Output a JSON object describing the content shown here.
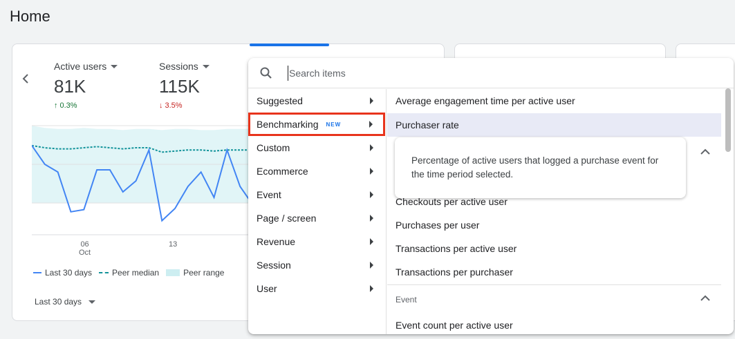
{
  "page": {
    "title": "Home"
  },
  "metrics": [
    {
      "label": "Active users",
      "value": "81K",
      "change": "0.3%",
      "direction": "up"
    },
    {
      "label": "Sessions",
      "value": "115K",
      "change": "3.5%",
      "direction": "down"
    }
  ],
  "chart_data": {
    "type": "line",
    "x_ticks": [
      {
        "day": "06",
        "month": "Oct"
      },
      {
        "day": "13",
        "month": ""
      }
    ],
    "series": [
      {
        "name": "Last 30 days",
        "color": "#4285f4",
        "style": "solid",
        "values": [
          0.82,
          0.65,
          0.58,
          0.22,
          0.24,
          0.6,
          0.6,
          0.4,
          0.5,
          0.78,
          0.14,
          0.25,
          0.45,
          0.58,
          0.35,
          0.78,
          0.45,
          0.28
        ]
      },
      {
        "name": "Peer median",
        "color": "#12939a",
        "style": "dashed",
        "values": [
          0.82,
          0.8,
          0.79,
          0.79,
          0.8,
          0.81,
          0.8,
          0.79,
          0.8,
          0.8,
          0.76,
          0.77,
          0.78,
          0.78,
          0.77,
          0.78,
          0.78,
          0.78
        ]
      },
      {
        "name": "Peer range",
        "color": "#cdeef1",
        "style": "area",
        "upper": [
          1.0,
          0.98,
          0.97,
          0.97,
          0.98,
          0.97,
          0.97,
          0.96,
          0.97,
          0.97,
          0.96,
          0.97,
          0.97,
          0.96,
          0.96,
          0.97,
          0.97,
          0.97
        ],
        "lower": [
          0.3,
          0.3,
          0.3,
          0.3,
          0.3,
          0.3,
          0.3,
          0.3,
          0.3,
          0.3,
          0.3,
          0.3,
          0.3,
          0.3,
          0.3,
          0.3,
          0.3,
          0.3
        ]
      }
    ],
    "legend": [
      "Last 30 days",
      "Peer median",
      "Peer range"
    ]
  },
  "date_range": {
    "label": "Last 30 days"
  },
  "search": {
    "placeholder": "Search items"
  },
  "categories": [
    {
      "label": "Suggested",
      "badge": ""
    },
    {
      "label": "Benchmarking",
      "badge": "NEW",
      "selected": true
    },
    {
      "label": "Custom",
      "badge": ""
    },
    {
      "label": "Ecommerce",
      "badge": ""
    },
    {
      "label": "Event",
      "badge": ""
    },
    {
      "label": "Page / screen",
      "badge": ""
    },
    {
      "label": "Revenue",
      "badge": ""
    },
    {
      "label": "Session",
      "badge": ""
    },
    {
      "label": "User",
      "badge": ""
    }
  ],
  "items": {
    "first": "Average engagement time per active user",
    "highlighted": "Purchaser rate",
    "after_tooltip": [
      "Checkouts per active user",
      "Purchases per user",
      "Transactions per active user",
      "Transactions per purchaser"
    ],
    "event_group_label": "Event",
    "event_items": [
      "Event count per active user"
    ]
  },
  "tooltip": {
    "text": "Percentage of active users that logged a purchase event for the time period selected."
  },
  "colors": {
    "accent": "#1a73e8",
    "highlight_border": "#e8341c",
    "up": "#137333",
    "down": "#c5221f"
  }
}
